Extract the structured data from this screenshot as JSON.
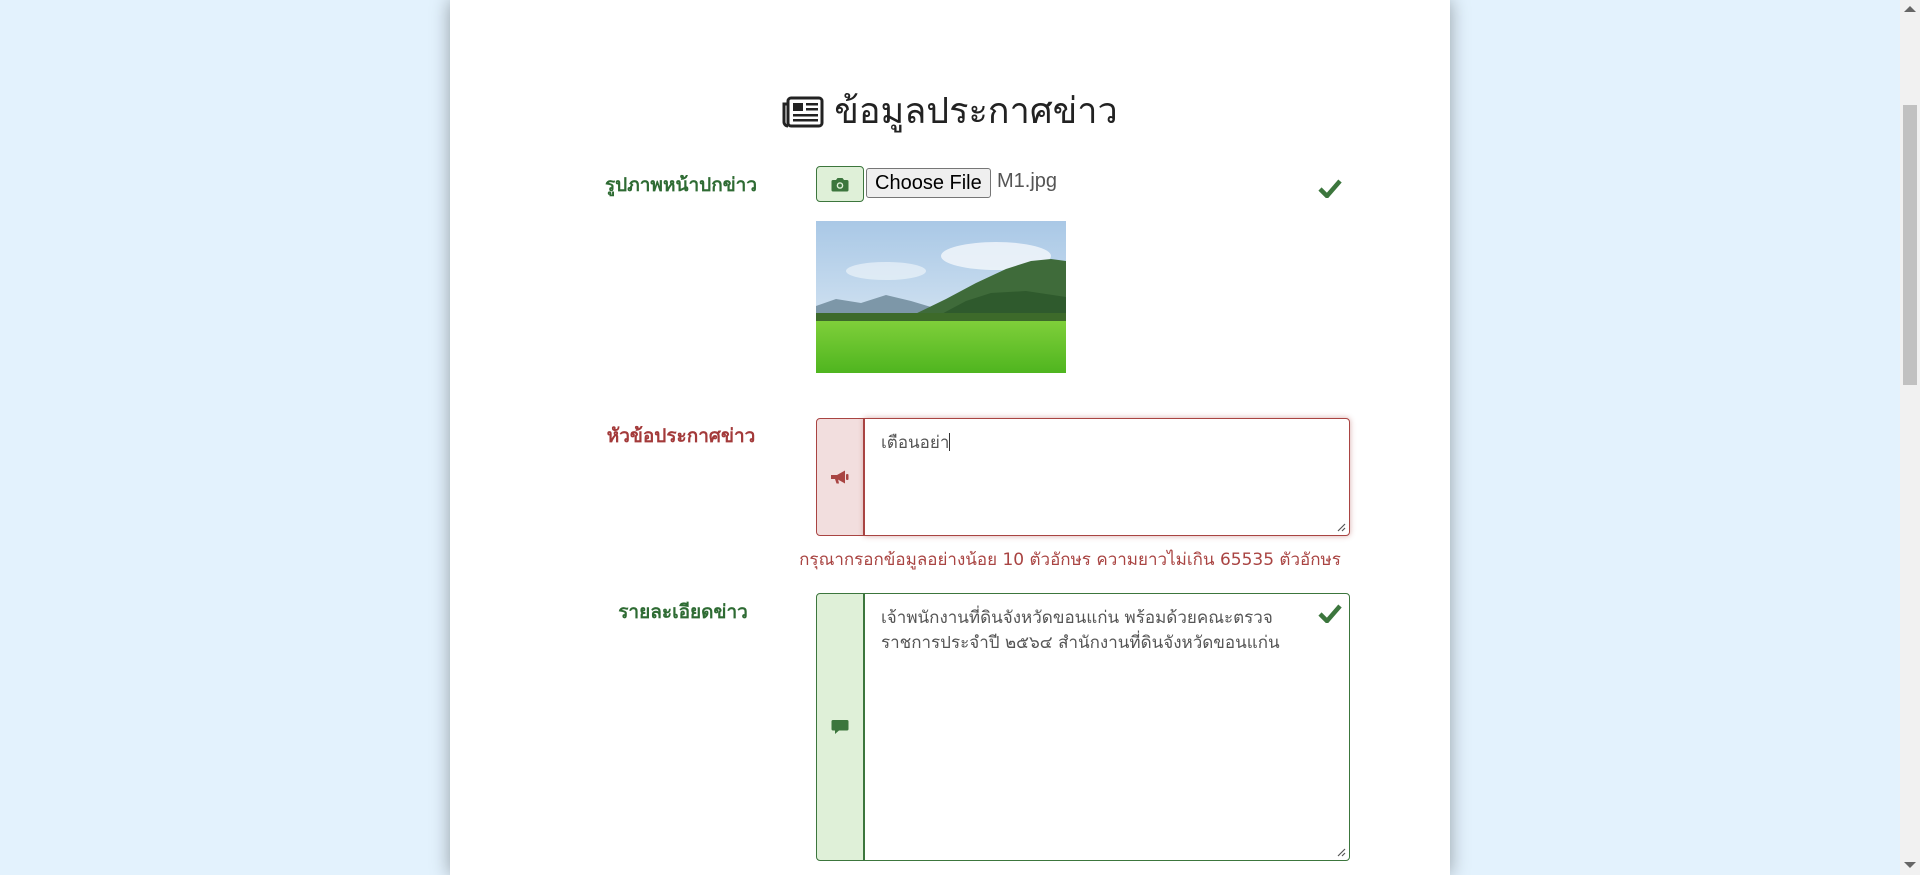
{
  "header": {
    "title": "ข้อมูลประกาศข่าว",
    "icon": "newspaper-icon"
  },
  "cover": {
    "label": "รูปภาพหน้าปกข่าว",
    "icon": "camera-icon",
    "file_button": "Choose File",
    "file_name": "M1.jpg",
    "status_icon": "check-icon"
  },
  "headline": {
    "label": "หัวข้อประกาศข่าว",
    "icon": "bullhorn-icon",
    "value": "เตือนอย่า",
    "help": "กรุณากรอกข้อมูลอย่างน้อย 10 ตัวอักษร ความยาวไม่เกิน 65535 ตัวอักษร"
  },
  "detail": {
    "label": "รายละเอียดข่าว",
    "icon": "comment-icon",
    "value": "เจ้าพนักงานที่ดินจังหวัดขอนแก่น พร้อมด้วยคณะตรวจราชการประจำปี ๒๕๖๔ สำนักงานที่ดินจังหวัดขอนแก่น",
    "status_icon": "check-icon"
  },
  "colors": {
    "success": "#3c763d",
    "error": "#a94442",
    "page_bg": "#e3f2fd"
  }
}
